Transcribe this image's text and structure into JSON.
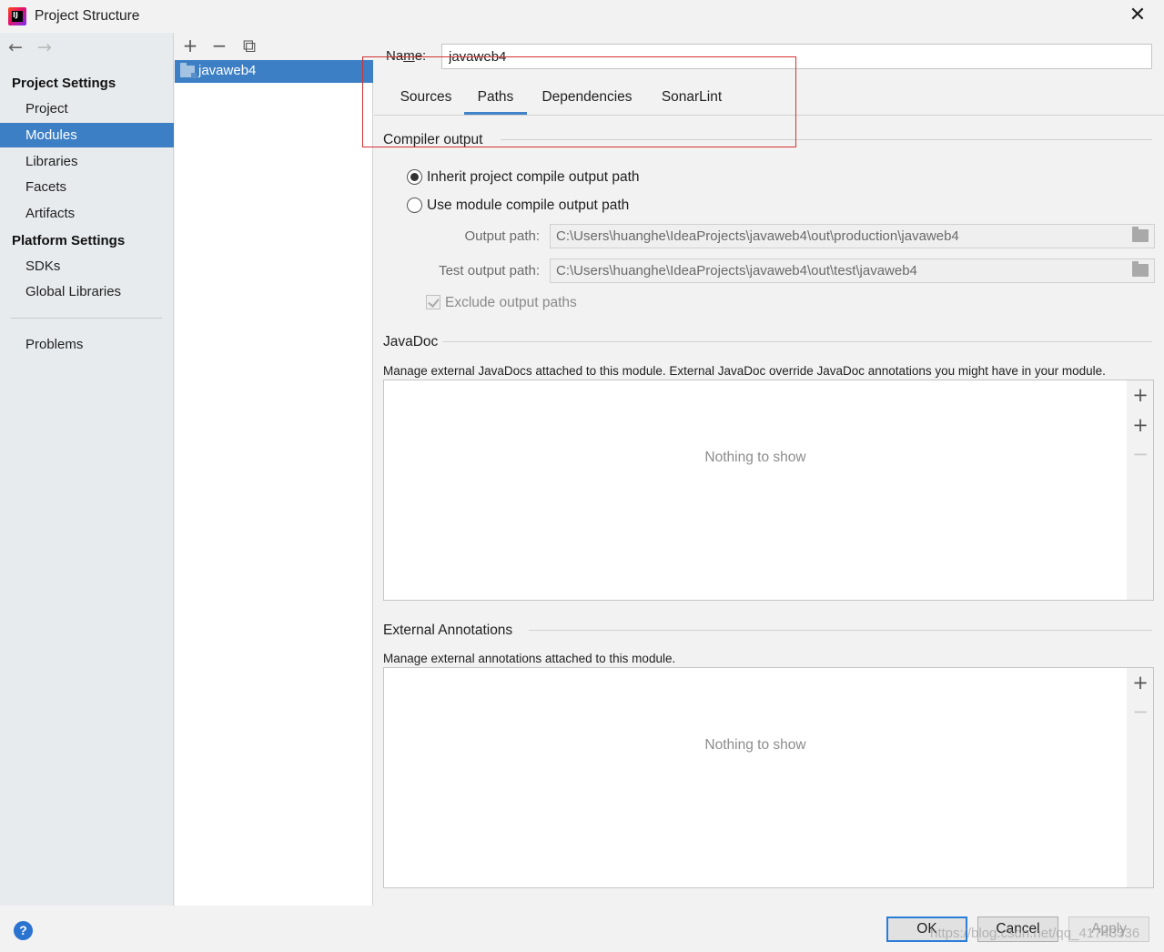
{
  "window": {
    "title": "Project Structure",
    "close_glyph": "✕",
    "app_icon_text": "IJ"
  },
  "sidebar": {
    "back_glyph": "←",
    "forward_glyph": "→",
    "project_settings_heading": "Project Settings",
    "project_items": [
      "Project",
      "Modules",
      "Libraries",
      "Facets",
      "Artifacts"
    ],
    "selected_item": "Modules",
    "platform_settings_heading": "Platform Settings",
    "platform_items": [
      "SDKs",
      "Global Libraries"
    ],
    "problems_label": "Problems"
  },
  "modules_panel": {
    "add_glyph": "+",
    "remove_glyph": "−",
    "copy_glyph": "⧉",
    "modules": [
      "javaweb4"
    ]
  },
  "main": {
    "name_label_pre": "Na",
    "name_label_u": "m",
    "name_label_post": "e:",
    "name_value": "javaweb4",
    "tabs": [
      "Sources",
      "Paths",
      "Dependencies",
      "SonarLint"
    ],
    "selected_tab": "Paths",
    "compiler_output": {
      "heading": "Compiler output",
      "inherit_label": "Inherit project compile output path",
      "use_module_label": "Use module compile output path",
      "selected_option": "inherit",
      "output_path_label": "Output path:",
      "output_path_value": "C:\\Users\\huanghe\\IdeaProjects\\javaweb4\\out\\production\\javaweb4",
      "test_output_path_label": "Test output path:",
      "test_output_path_value": "C:\\Users\\huanghe\\IdeaProjects\\javaweb4\\out\\test\\javaweb4",
      "exclude_label": "Exclude output paths",
      "exclude_checked": true
    },
    "javadoc": {
      "heading": "JavaDoc",
      "description": "Manage external JavaDocs attached to this module. External JavaDoc override JavaDoc annotations you might have in your module.",
      "empty_text": "Nothing to show",
      "add_glyph": "+",
      "add_url_glyph": "+",
      "remove_glyph": "−"
    },
    "external_annotations": {
      "heading": "External Annotations",
      "description": "Manage external annotations attached to this module.",
      "empty_text": "Nothing to show",
      "add_glyph": "+",
      "remove_glyph": "−"
    }
  },
  "footer": {
    "help_glyph": "?",
    "ok_label": "OK",
    "cancel_label": "Cancel",
    "apply_label": "Apply",
    "watermark": "https://blog.csdn.net/qq_41743336"
  },
  "colors": {
    "selection": "#3d7fc5",
    "tab_underline": "#4083c9",
    "annotation_box": "#d33232",
    "help_button": "#2b73d1"
  }
}
